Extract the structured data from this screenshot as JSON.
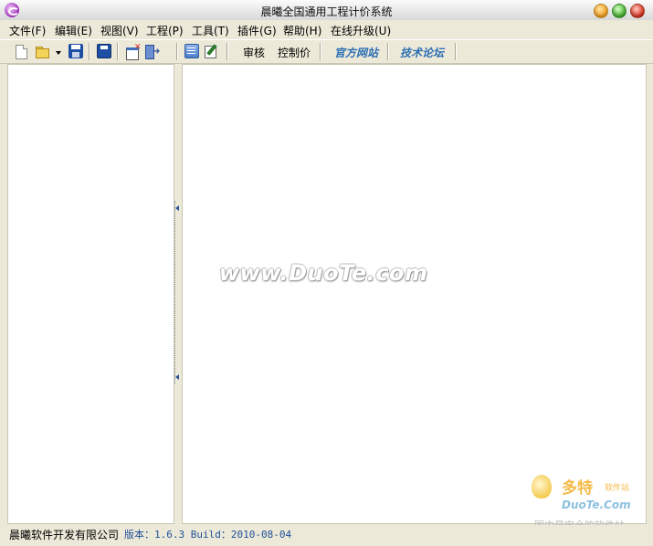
{
  "window": {
    "title": "晨曦全国通用工程计价系统"
  },
  "menu": [
    {
      "label": "文件(F)"
    },
    {
      "label": "编辑(E)"
    },
    {
      "label": "视图(V)"
    },
    {
      "label": "工程(P)"
    },
    {
      "label": "工具(T)"
    },
    {
      "label": "插件(G)"
    },
    {
      "label": "帮助(H)"
    },
    {
      "label": "在线升级(U)"
    }
  ],
  "toolbar": {
    "audit_label": "审核",
    "control_price_label": "控制价",
    "official_site_label": "官方网站",
    "tech_forum_label": "技术论坛",
    "icons": [
      "new-file-icon",
      "open-folder-icon",
      "dropdown-arrow-icon",
      "save-icon",
      "save-all-icon",
      "close-window-icon",
      "exit-icon",
      "book-icon",
      "edit-icon"
    ]
  },
  "watermark": {
    "text": "www.DuoTe.com"
  },
  "logo": {
    "name": "多特",
    "sub": "软件站",
    "domain": "DuoTe.Com",
    "tagline": "国内最安全的软件站"
  },
  "status": {
    "company": "晨曦软件开发有限公司",
    "version": "版本：1.6.3 Build：2010-08-04"
  },
  "colors": {
    "window_bg": "#ece9d8",
    "link_blue": "#2c6fb3",
    "version_blue": "#1f4f9a"
  }
}
